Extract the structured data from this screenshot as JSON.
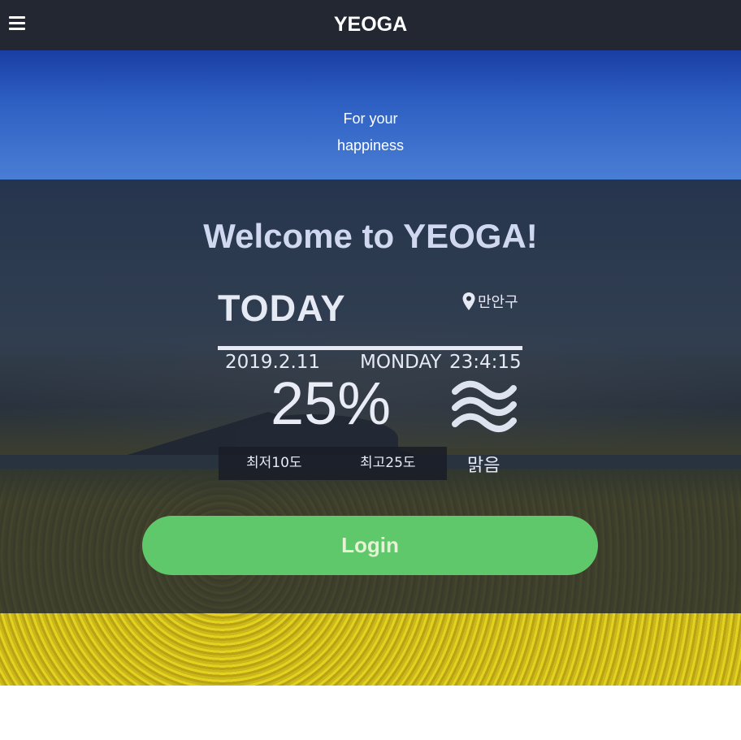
{
  "app": {
    "brand": "YEOGA",
    "menu_icon": "hamburger-menu-icon"
  },
  "hero": {
    "tagline_line1": "For your",
    "tagline_line2": "happiness",
    "welcome": "Welcome to YEOGA!"
  },
  "weather": {
    "heading": "TODAY",
    "location": "만안구",
    "location_icon": "map-pin-icon",
    "date": "2019.2.11",
    "weekday": "MONDAY",
    "time": "23:4:15",
    "humidity": "25%",
    "condition_icon": "wave-icon",
    "min_temp": "최저10도",
    "max_temp": "최고25도",
    "condition": "맑음"
  },
  "actions": {
    "login_label": "Login"
  },
  "colors": {
    "navbar": "#222732",
    "login_button": "#5ec86a",
    "overlay": "#1e2430"
  }
}
